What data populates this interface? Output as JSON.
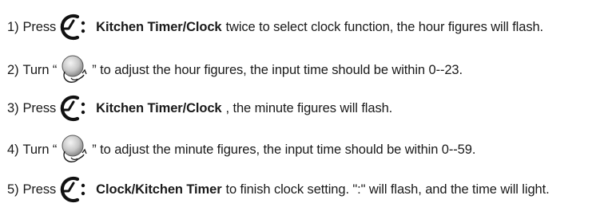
{
  "steps": [
    {
      "num": "1)",
      "press": "Press",
      "button": "Kitchen Timer/Clock",
      "rest": "twice to select clock function, the hour figures will flash.",
      "icon": "clock-timer-button-icon"
    },
    {
      "num": "2)",
      "turn": "Turn “",
      "rest": "” to adjust the hour figures, the input time should be within 0--23.",
      "icon": "rotary-knob-icon"
    },
    {
      "num": "3)",
      "press": "Press",
      "button": "Kitchen Timer/Clock",
      "rest": ", the minute figures will flash.",
      "icon": "clock-timer-button-icon"
    },
    {
      "num": "4)",
      "turn": "Turn “",
      "rest": "” to adjust the minute figures, the input time should be within 0--59.",
      "icon": "rotary-knob-icon"
    },
    {
      "num": "5)",
      "press": "Press",
      "button": "Clock/Kitchen Timer",
      "rest": "to finish clock setting. \":\" will flash, and the time will light.",
      "icon": "clock-timer-button-icon"
    }
  ]
}
